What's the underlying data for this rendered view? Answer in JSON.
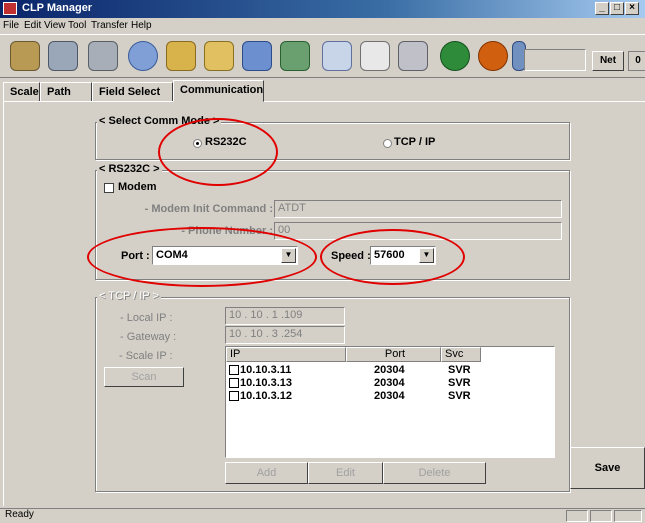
{
  "window": {
    "title": "CLP Manager",
    "min_symbol": "_",
    "max_symbol": "□",
    "close_symbol": "×"
  },
  "menu": [
    "File",
    "Edit",
    "View",
    "Tool",
    "Transfer",
    "Help"
  ],
  "toolbar": {
    "icons": [
      "open-folder-icon",
      "save-disk-icon",
      "printer-icon",
      "globe-icon",
      "star-icon",
      "folder-user-icon",
      "folder-person-icon",
      "people-icon",
      "grid-icon",
      "label-icon",
      "keyboard-icon",
      "green-arrow-icon",
      "orange-arrow-icon",
      "tools-icon"
    ],
    "net_label": "Net",
    "counter_value": "0"
  },
  "tabs": [
    "Scale",
    "Path",
    "Field Select",
    "Communication"
  ],
  "comm_mode": {
    "label": "< Select Comm Mode >",
    "option_rs232c": "RS232C",
    "option_tcpip": "TCP / IP",
    "selected": "RS232C"
  },
  "rs232c": {
    "label": "< RS232C >",
    "modem_label": "Modem",
    "modem_init_label": "- Modem Init Command :",
    "modem_init_value": "ATDT",
    "phone_label": "- Phone Number :",
    "phone_value": "00",
    "port_label": "Port :",
    "port_value": "COM4",
    "speed_label": "Speed :",
    "speed_value": "57600"
  },
  "tcpip": {
    "label": "< TCP / IP >",
    "local_ip_label": "- Local IP :",
    "local_ip_value": "10 . 10 . 1 .109",
    "gateway_label": "- Gateway :",
    "gateway_value": "10 . 10 . 3 .254",
    "scale_ip_label": "- Scale IP :",
    "scan_label": "Scan",
    "columns": [
      "IP",
      "Port",
      "Svc"
    ],
    "rows": [
      {
        "ip": "10.10.3.11",
        "port": "20304",
        "svc": "SVR"
      },
      {
        "ip": "10.10.3.13",
        "port": "20304",
        "svc": "SVR"
      },
      {
        "ip": "10.10.3.12",
        "port": "20304",
        "svc": "SVR"
      }
    ],
    "add_label": "Add",
    "edit_label": "Edit",
    "delete_label": "Delete"
  },
  "save_label": "Save",
  "status": "Ready",
  "accent_colors": {
    "titlebar": "#0a246a",
    "annotation": "#e00000"
  }
}
